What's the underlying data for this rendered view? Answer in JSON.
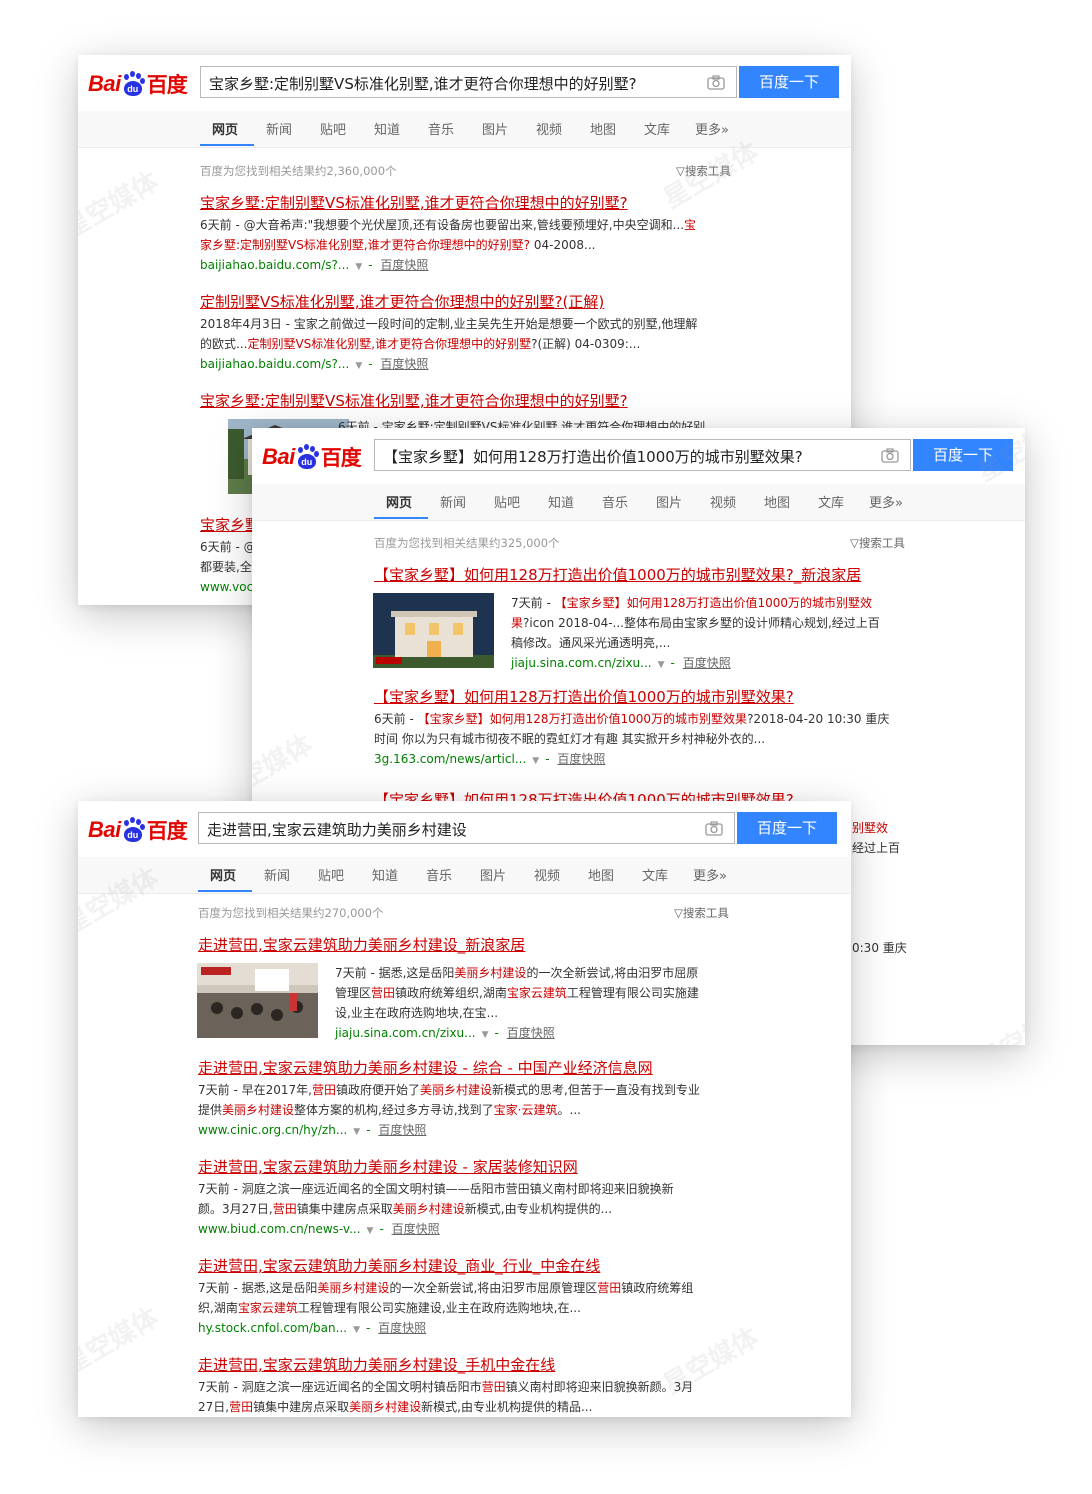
{
  "logo": {
    "bai": "Bai",
    "du": "du",
    "cn": "百度"
  },
  "tabs": [
    "网页",
    "新闻",
    "贴吧",
    "知道",
    "音乐",
    "图片",
    "视频",
    "地图",
    "文库",
    "更多»"
  ],
  "search_button": "百度一下",
  "tools_label": "搜索工具",
  "cache_label": "百度快照",
  "watermark": "星空媒体",
  "card1": {
    "query": "宝家乡墅:定制别墅VS标准化别墅,谁才更符合你理想中的好别墅?",
    "count": "百度为您找到相关结果约2,360,000个",
    "r1": {
      "title": "宝家乡墅:定制别墅VS标准化别墅,谁才更符合你理想中的好别墅?",
      "l1a": "6天前 - @大音希声:\"我想要个光伏屋顶,还有设备房也要留出来,管线要预埋好,中央空调和...",
      "l1b": "宝",
      "l2a": "家乡墅:定制别墅VS标准化别墅,谁才更符合你理想中的好别墅?",
      "l2b": " 04-2008...",
      "url": "baijiahao.baidu.com/s?..."
    },
    "r2": {
      "title": "定制别墅VS标准化别墅,谁才更符合你理想中的好别墅?(正解)",
      "l1": "2018年4月3日 - 宝家之前做过一段时间的定制,业主吴先生开始是想要一个欧式的别墅,他理解",
      "l2a": "的欧式...",
      "l2b": "定制别墅VS标准化别墅,谁才更符合你理想中的好别墅",
      "l2c": "?(正解) 04-0309:...",
      "url": "baijiahao.baidu.com/s?..."
    },
    "r3": {
      "title": "宝家乡墅:定制别墅VS标准化别墅,谁才更符合你理想中的好别墅?",
      "l1": "6天前 - 宝家乡墅:定制别墅VS标准化别墅,谁才更符合你理想中的好别"
    },
    "r4": {
      "title": "宝家乡墅",
      "l1": "6天前 - @",
      "l2": "都要装,全",
      "url": "www.voc"
    }
  },
  "card2": {
    "query": "【宝家乡墅】如何用128万打造出价值1000万的城市别墅效果?",
    "count": "百度为您找到相关结果约325,000个",
    "r1": {
      "title": "【宝家乡墅】如何用128万打造出价值1000万的城市别墅效果?_新浪家居",
      "l1a": "7天前 - ",
      "l1b": "【宝家乡墅】如何用128万打造出价值1000万的城市别墅效",
      "l2a": "果",
      "l2b": "?icon 2018-04-...整体布局由宝家乡墅的设计师精心规划,经过上百",
      "l3": "稿修改。通风采光通透明亮,...",
      "url": "jiaju.sina.com.cn/zixu..."
    },
    "r2": {
      "title": "【宝家乡墅】如何用128万打造出价值1000万的城市别墅效果?",
      "l1a": "6天前 - ",
      "l1b": "【宝家乡墅】如何用128万打造出价值1000万的城市别墅效果",
      "l1c": "?2018-04-20 10:30 重庆",
      "l2": "时间 你以为只有城市彻夜不眠的霓虹灯才有趣 其实掀开乡村神秘外衣的...",
      "url": "3g.163.com/news/articl..."
    },
    "r3": {
      "title": "【宝家乡墅】如何用128万打造出价值1000万的城市别墅效果?"
    },
    "peek": {
      "p1": "别墅效",
      "p2": "经过上百",
      "p3": "0:30 重庆"
    }
  },
  "card3": {
    "query": "走进营田,宝家云建筑助力美丽乡村建设",
    "count": "百度为您找到相关结果约270,000个",
    "r1": {
      "title": "走进营田,宝家云建筑助力美丽乡村建设_新浪家居",
      "l1a": "7天前 - 据悉,这是岳阳",
      "l1b": "美丽乡村建设",
      "l1c": "的一次全新尝试,将由汨罗市屈原",
      "l2a": "管理区",
      "l2b": "营田",
      "l2c": "镇政府统筹组织,湖南",
      "l2d": "宝家云建筑",
      "l2e": "工程管理有限公司实施建",
      "l3": "设,业主在政府选购地块,在宝...",
      "url": "jiaju.sina.com.cn/zixu..."
    },
    "r2": {
      "title": "走进营田,宝家云建筑助力美丽乡村建设 - 综合 - 中国产业经济信息网",
      "l1a": "7天前 - 早在2017年,",
      "l1b": "营田",
      "l1c": "镇政府便开始了",
      "l1d": "美丽乡村建设",
      "l1e": "新模式的思考,但苦于一直没有找到专业",
      "l2a": "提供",
      "l2b": "美丽乡村建设",
      "l2c": "整体方案的机构,经过多方寻访,找到了",
      "l2d": "宝家·云建筑",
      "l2e": "。...",
      "url": "www.cinic.org.cn/hy/zh..."
    },
    "r3": {
      "title": "走进营田,宝家云建筑助力美丽乡村建设 - 家居装修知识网",
      "l1": "7天前 - 洞庭之滨一座远近闻名的全国文明村镇——岳阳市营田镇义南村即将迎来旧貌换新",
      "l2a": "颜。3月27日,",
      "l2b": "营田",
      "l2c": "镇集中建房点采取",
      "l2d": "美丽乡村建设",
      "l2e": "新模式,由专业机构提供的...",
      "url": "www.biud.com.cn/news-v..."
    },
    "r4": {
      "title": "走进营田,宝家云建筑助力美丽乡村建设_商业_行业_中金在线",
      "l1a": "7天前 - 据悉,这是岳阳",
      "l1b": "美丽乡村建设",
      "l1c": "的一次全新尝试,将由汨罗市屈原管理区",
      "l1d": "营田",
      "l1e": "镇政府统筹组",
      "l2a": "织,湖南",
      "l2b": "宝家云建筑",
      "l2c": "工程管理有限公司实施建设,业主在政府选购地块,在...",
      "url": "hy.stock.cnfol.com/ban..."
    },
    "r5": {
      "title": "走进营田,宝家云建筑助力美丽乡村建设_手机中金在线",
      "l1a": "7天前 - 洞庭之滨一座远近闻名的全国文明村镇岳阳市",
      "l1b": "营田",
      "l1c": "镇义南村即将迎来旧貌换新颜。3月",
      "l2a": "27日,",
      "l2b": "营田",
      "l2c": "镇集中建房点采取",
      "l2d": "美丽乡村建设",
      "l2e": "新模式,由专业机构提供的精品..."
    }
  }
}
